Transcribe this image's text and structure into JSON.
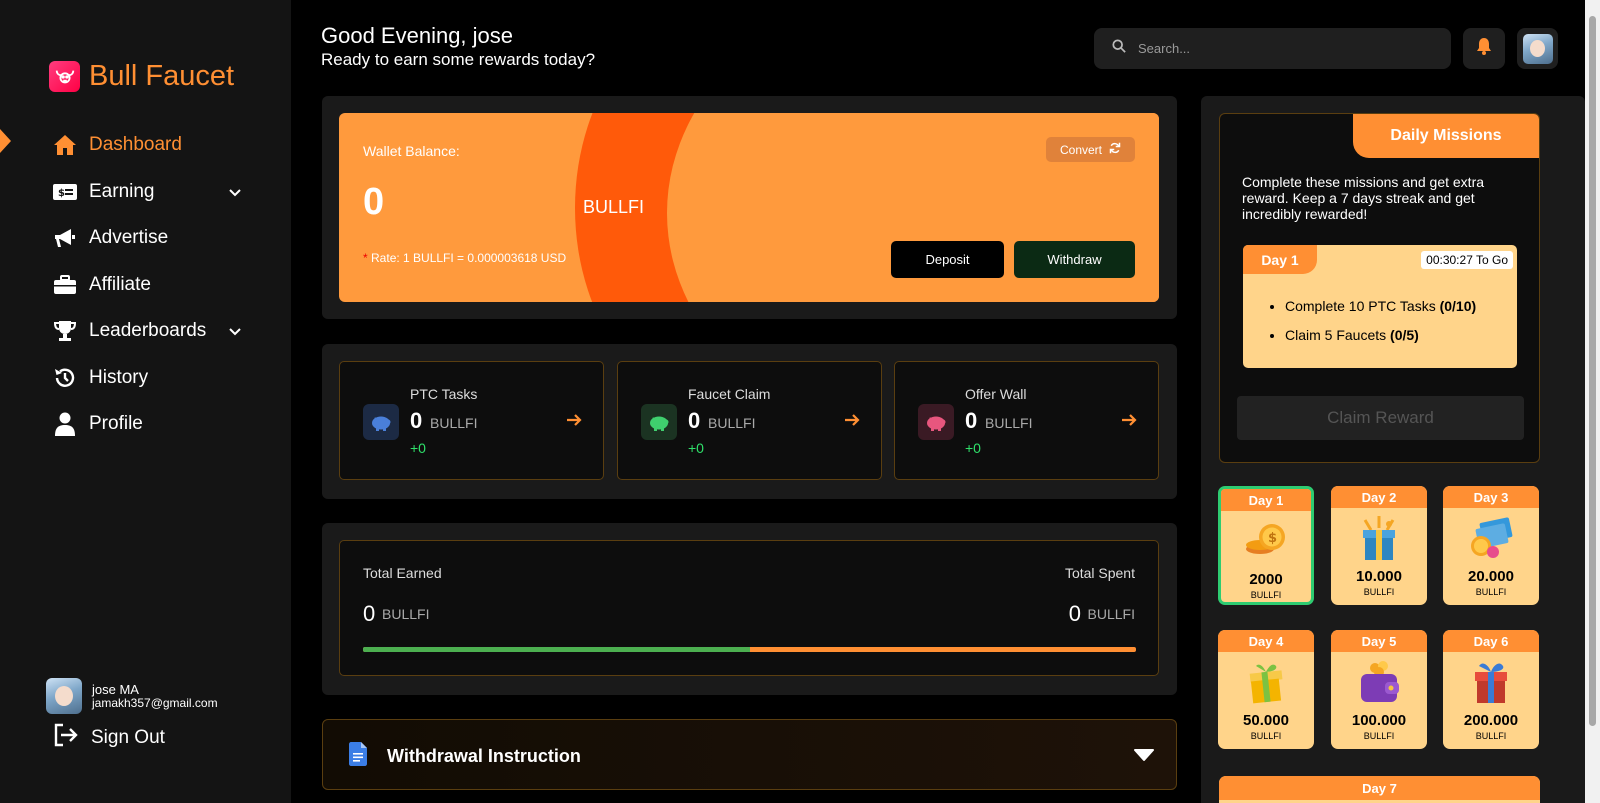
{
  "brand": {
    "name": "Bull Faucet"
  },
  "nav": {
    "items": [
      {
        "label": "Dashboard"
      },
      {
        "label": "Earning"
      },
      {
        "label": "Advertise"
      },
      {
        "label": "Affiliate"
      },
      {
        "label": "Leaderboards"
      },
      {
        "label": "History"
      },
      {
        "label": "Profile"
      }
    ]
  },
  "user": {
    "name": "jose MA",
    "email": "jamakh357@gmail.com",
    "signout_label": "Sign Out"
  },
  "header": {
    "greeting": "Good Evening, jose",
    "subtitle": "Ready to earn some rewards today?",
    "search_placeholder": "Search..."
  },
  "wallet": {
    "label": "Wallet Balance:",
    "value": "0",
    "unit": "BULLFI",
    "rate": "Rate: 1 BULLFI = 0.000003618 USD",
    "rate_star": "*",
    "convert_label": "Convert",
    "deposit_label": "Deposit",
    "withdraw_label": "Withdraw"
  },
  "stats": [
    {
      "title": "PTC Tasks",
      "value": "0",
      "unit": "BULLFI",
      "delta": "+0",
      "color": "#4a7fd9"
    },
    {
      "title": "Faucet Claim",
      "value": "0",
      "unit": "BULLFI",
      "delta": "+0",
      "color": "#3fcf6e"
    },
    {
      "title": "Offer Wall",
      "value": "0",
      "unit": "BULLFI",
      "delta": "+0",
      "color": "#e8567e"
    }
  ],
  "totals": {
    "earned_label": "Total Earned",
    "earned_value": "0",
    "earned_unit": "BULLFI",
    "spent_label": "Total Spent",
    "spent_value": "0",
    "spent_unit": "BULLFI",
    "earned_fraction": 0.5
  },
  "withdrawal": {
    "title": "Withdrawal Instruction"
  },
  "missions": {
    "title": "Daily Missions",
    "description": "Complete these missions and get extra reward. Keep a 7 days streak and get incredibly rewarded!",
    "day_label": "Day 1",
    "timer": "00:30:27 To Go",
    "tasks": [
      {
        "text": "Complete 10 PTC Tasks",
        "progress": "(0/10)"
      },
      {
        "text": "Claim 5 Faucets",
        "progress": "(0/5)"
      }
    ],
    "claim_label": "Claim Reward"
  },
  "rewards": [
    {
      "day": "Day 1",
      "amount": "2000",
      "unit": "BULLFI",
      "icon": "coins-icon"
    },
    {
      "day": "Day 2",
      "amount": "10.000",
      "unit": "BULLFI",
      "icon": "gift-box-icon"
    },
    {
      "day": "Day 3",
      "amount": "20.000",
      "unit": "BULLFI",
      "icon": "cash-coins-icon"
    },
    {
      "day": "Day 4",
      "amount": "50.000",
      "unit": "BULLFI",
      "icon": "gift-box-icon"
    },
    {
      "day": "Day 5",
      "amount": "100.000",
      "unit": "BULLFI",
      "icon": "wallet-icon"
    },
    {
      "day": "Day 6",
      "amount": "200.000",
      "unit": "BULLFI",
      "icon": "gift-box-icon"
    },
    {
      "day": "Day 7"
    }
  ],
  "colors": {
    "accent": "#ff8f33",
    "wallet_bg": "#ff9a3d",
    "wallet_arc": "#ff5a0a",
    "success": "#2fe06a"
  }
}
